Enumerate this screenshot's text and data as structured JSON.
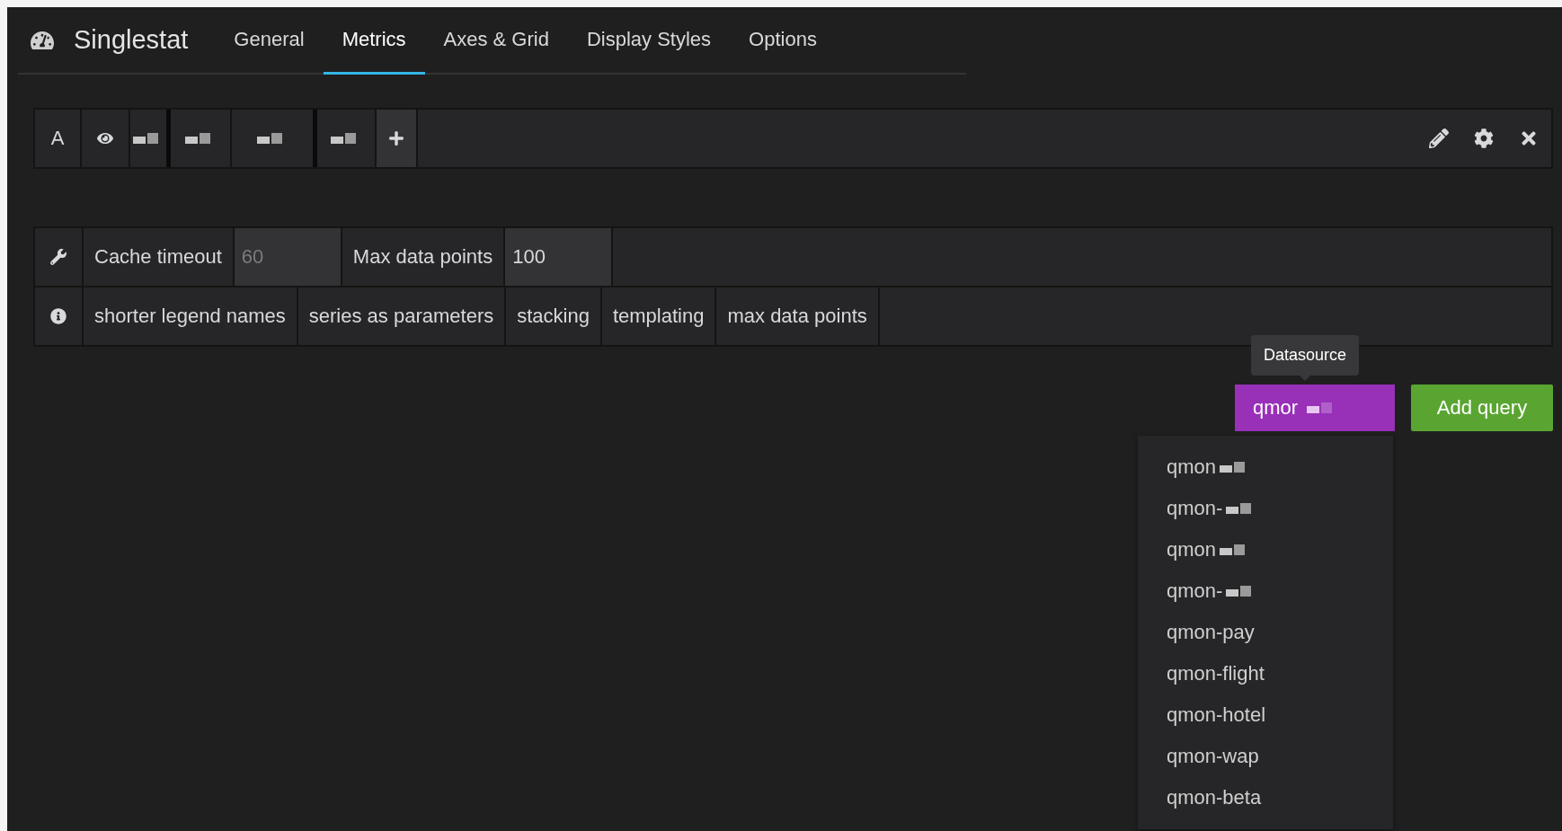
{
  "panel": {
    "title": "Singlestat"
  },
  "tabs": [
    {
      "label": "General",
      "selected": false
    },
    {
      "label": "Metrics",
      "selected": true
    },
    {
      "label": "Axes & Grid",
      "selected": false
    },
    {
      "label": "Display Styles",
      "selected": false
    },
    {
      "label": "Options",
      "selected": false
    }
  ],
  "query": {
    "ref_id": "A",
    "segments": [
      {
        "kind": "redacted",
        "dark_edge": true
      },
      {
        "kind": "redacted",
        "dark_edge": false
      },
      {
        "kind": "redacted",
        "dark_edge": true
      },
      {
        "kind": "redacted",
        "dark_edge": false
      }
    ]
  },
  "options": {
    "fields": [
      {
        "label": "Cache timeout",
        "placeholder": "60"
      },
      {
        "label": "Max data points",
        "value": "100"
      }
    ],
    "help_links": [
      "shorter legend names",
      "series as parameters",
      "stacking",
      "templating",
      "max data points"
    ]
  },
  "datasource": {
    "tooltip": "Datasource",
    "label": "qmor",
    "redacted": true
  },
  "add_query": "Add query",
  "datasource_menu": [
    {
      "label": "qmon",
      "redacted": true
    },
    {
      "label": "qmon-",
      "redacted": true
    },
    {
      "label": "qmon",
      "redacted": true
    },
    {
      "label": "qmon-",
      "redacted": true
    },
    {
      "label": "qmon-pay",
      "redacted": false
    },
    {
      "label": "qmon-flight",
      "redacted": false
    },
    {
      "label": "qmon-hotel",
      "redacted": false
    },
    {
      "label": "qmon-wap",
      "redacted": false
    },
    {
      "label": "qmon-beta",
      "redacted": false
    }
  ]
}
